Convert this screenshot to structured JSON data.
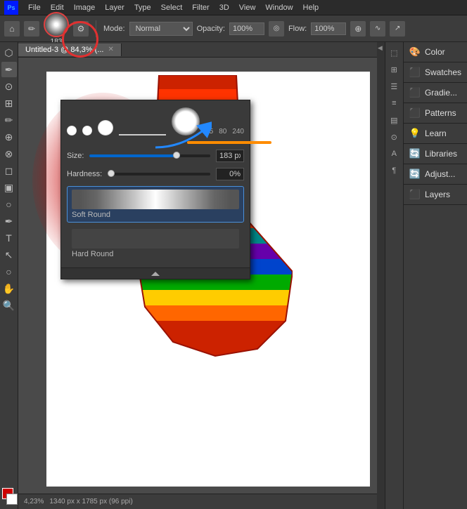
{
  "app": {
    "title": "Adobe Photoshop"
  },
  "menubar": {
    "items": [
      "PS",
      "File",
      "Edit",
      "Image",
      "Layer",
      "Type",
      "Select",
      "Filter",
      "3D",
      "View",
      "Window",
      "Help"
    ]
  },
  "toolbar_top": {
    "brush_size": "183",
    "brush_size_unit": "px",
    "mode_label": "Mode:",
    "mode_value": "Normal",
    "opacity_label": "Opacity:",
    "opacity_value": "100%",
    "flow_label": "Flow:",
    "flow_value": "100%"
  },
  "brush_popup": {
    "size_label": "Size:",
    "size_value": "183 px",
    "hardness_label": "Hardness:",
    "hardness_value": "0%",
    "brush_sizes": [
      "15",
      "80",
      "240"
    ],
    "brushes": [
      {
        "name": "Soft Round",
        "selected": true
      },
      {
        "name": "Hard Round",
        "selected": false
      }
    ]
  },
  "tab": {
    "title": "Untitled-3 @ 84,3% (..."
  },
  "status_bar": {
    "zoom": "4,23%",
    "dimensions": "1340 px x 1785 px (96 ppi)"
  },
  "right_panel": {
    "sections": [
      {
        "id": "color",
        "label": "Color",
        "icon": "🎨"
      },
      {
        "id": "swatches",
        "label": "Swatches",
        "icon": "⬛"
      },
      {
        "id": "gradients",
        "label": "Gradie...",
        "icon": "⬛"
      },
      {
        "id": "patterns",
        "label": "Patterns",
        "icon": "⬛"
      },
      {
        "id": "learn",
        "label": "Learn",
        "icon": "💡"
      },
      {
        "id": "libraries",
        "label": "Libraries",
        "icon": "🔄"
      },
      {
        "id": "adjustments",
        "label": "Adjust...",
        "icon": "🔄"
      },
      {
        "id": "layers",
        "label": "Layers",
        "icon": "⬛"
      }
    ]
  },
  "toolbox": {
    "tools": [
      "⌂",
      "✏",
      "T",
      "⬚",
      "⊕",
      "⊗",
      "✂",
      "⬡",
      "✒",
      "🖊",
      "🔍",
      "✋",
      "🔲",
      "⚙"
    ]
  },
  "annotations": {
    "red_circle": "brush size indicator circle",
    "blue_arrow": "pointing to size input",
    "orange_line": "pointing to hardness slider"
  }
}
